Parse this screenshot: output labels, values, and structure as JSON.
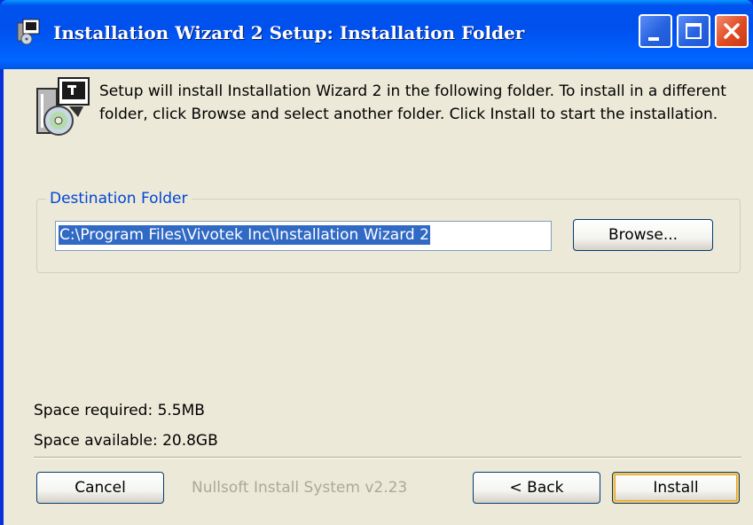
{
  "window": {
    "title": "Installation Wizard 2 Setup: Installation Folder"
  },
  "intro_text": "Setup will install Installation Wizard 2 in the following folder. To install in a different folder, click Browse and select another folder. Click Install to start the installation.",
  "destination": {
    "group_label": "Destination Folder",
    "path_value": "C:\\Program Files\\Vivotek Inc\\Installation Wizard 2",
    "browse_label": "Browse..."
  },
  "space": {
    "required": "Space required: 5.5MB",
    "available": "Space available: 20.8GB"
  },
  "footer": {
    "branding": "Nullsoft Install System v2.23",
    "cancel_label": "Cancel",
    "back_label": "< Back",
    "install_label": "Install"
  },
  "icons": {
    "title": "installer-icon",
    "setup": "setup-cd-icon",
    "minimize": "minimize-icon",
    "maximize": "maximize-icon",
    "close": "close-icon"
  },
  "colors": {
    "titlebar": "#0054E3",
    "dialog_bg": "#ECE9D8",
    "group_label": "#0046D5",
    "selection": "#316AC5",
    "close_button": "#E04A23"
  }
}
